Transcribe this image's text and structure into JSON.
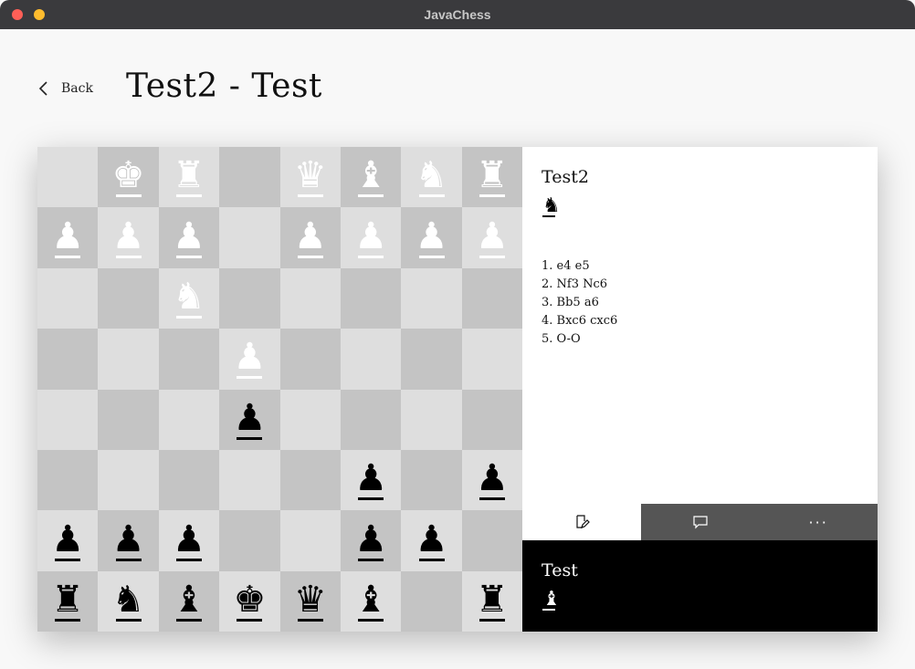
{
  "window": {
    "title": "JavaChess"
  },
  "header": {
    "back_label": "Back",
    "title": "Test2 - Test"
  },
  "board": {
    "rows": [
      [
        "",
        "wK",
        "wR",
        "",
        "wQ",
        "wB",
        "wN",
        "wR"
      ],
      [
        "wP",
        "wP",
        "wP",
        "",
        "wP",
        "wP",
        "wP",
        "wP"
      ],
      [
        "",
        "",
        "wN",
        "",
        "",
        "",
        "",
        ""
      ],
      [
        "",
        "",
        "",
        "wP",
        "",
        "",
        "",
        ""
      ],
      [
        "",
        "",
        "",
        "bP",
        "",
        "",
        "",
        ""
      ],
      [
        "",
        "",
        "",
        "",
        "",
        "bP",
        "",
        "bP"
      ],
      [
        "bP",
        "bP",
        "bP",
        "",
        "",
        "bP",
        "bP",
        ""
      ],
      [
        "bR",
        "bN",
        "bB",
        "bK",
        "bQ",
        "bB",
        "",
        "bR"
      ]
    ]
  },
  "top_player": {
    "name": "Test2",
    "icon": "knight-icon"
  },
  "moves": [
    "1. e4 e5",
    "2. Nf3 Nc6",
    "3. Bb5 a6",
    "4. Bxc6 cxc6",
    "5. O-O"
  ],
  "tabs": [
    {
      "name": "notation",
      "icon": "edit-notation-icon",
      "active": true
    },
    {
      "name": "chat",
      "icon": "chat-icon",
      "active": false
    },
    {
      "name": "more",
      "icon": "more-icon",
      "label": "···",
      "active": false
    }
  ],
  "bottom_player": {
    "name": "Test",
    "icon": "bishop-icon"
  },
  "colors": {
    "titlebar": "#3a3a3d",
    "light_square": "#dedede",
    "dark_square": "#c4c4c4",
    "tab_inactive": "#555555",
    "bottom_panel": "#000000"
  }
}
